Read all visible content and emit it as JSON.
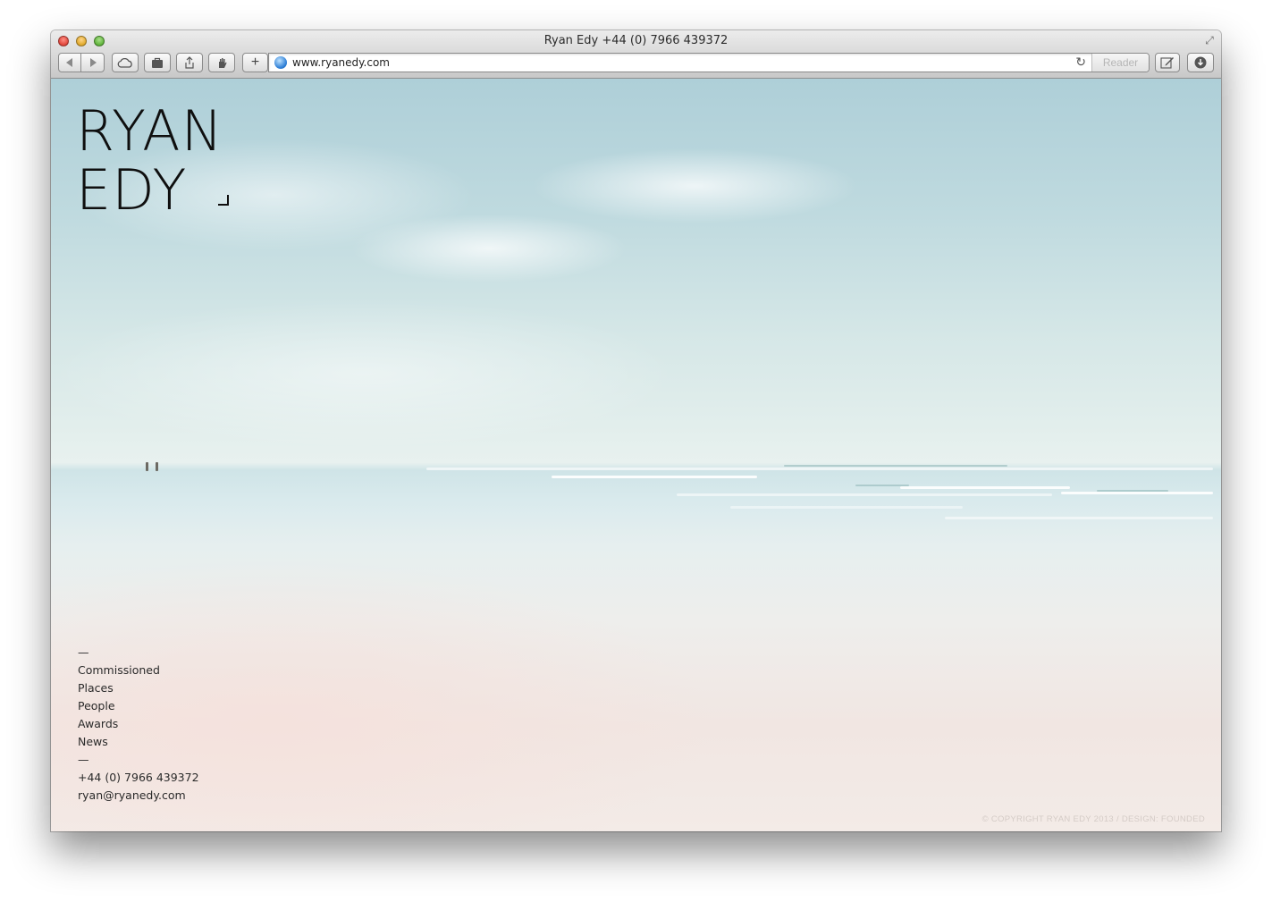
{
  "window": {
    "title": "Ryan Edy +44 (0) 7966 439372"
  },
  "toolbar": {
    "back_icon": "back-arrow-icon",
    "forward_icon": "forward-arrow-icon",
    "icloud_icon": "cloud-icon",
    "bag_icon": "bag-icon",
    "share_icon": "share-icon",
    "hand_icon": "hand-icon",
    "plus_label": "+",
    "url": "www.ryanedy.com",
    "reader_label": "Reader",
    "note_icon": "pencil-icon",
    "download_icon": "download-icon"
  },
  "site": {
    "logo_line1": "RYAN",
    "logo_line2": "EDY",
    "nav_divider_top": "—",
    "nav": [
      {
        "label": "Commissioned"
      },
      {
        "label": "Places"
      },
      {
        "label": "People"
      },
      {
        "label": "Awards"
      },
      {
        "label": "News"
      }
    ],
    "nav_divider_bottom": "—",
    "phone": "+44 (0) 7966 439372",
    "email": "ryan@ryanedy.com",
    "copyright": "© COPYRIGHT RYAN EDY 2013 / DESIGN: FOUNDED"
  },
  "colors": {
    "sky_top": "#aecfd8",
    "sand": "#f3ebe7",
    "text": "#2a2a2a",
    "copyright": "#d4cbc6"
  }
}
